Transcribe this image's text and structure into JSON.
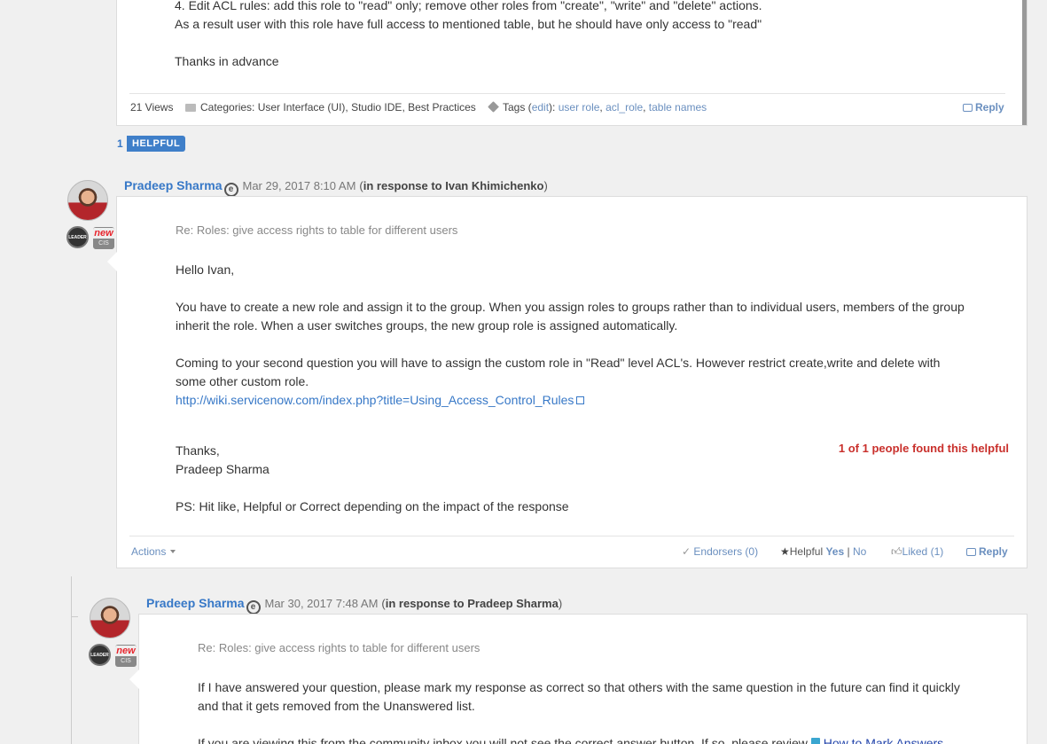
{
  "top_post": {
    "line1": "4. Edit ACL rules: add this role to \"read\" only; remove other roles from \"create\", \"write\" and \"delete\" actions.",
    "line2": "As a result user with this role have full access to mentioned table, but he should have only access to \"read\"",
    "thanks": "Thanks in advance",
    "views": "21 Views",
    "categories_label": "Categories:",
    "categories": "User Interface (UI), Studio IDE, Best Practices",
    "tags_label": "Tags (",
    "tags_edit": "edit",
    "tags_suffix": "):",
    "tags": [
      "user role",
      "acl_role",
      "table names"
    ],
    "reply_label": "Reply",
    "helpful_count": "1",
    "helpful_badge": "HELPFUL"
  },
  "reply1": {
    "author": "Pradeep Sharma",
    "date": "Mar 29, 2017 8:10 AM",
    "in_response_prefix": "(",
    "in_response": "in response to Ivan Khimichenko",
    "in_response_suffix": ")",
    "badge_leader": "LEADER",
    "badge_new": "new",
    "badge_cis": "CIS",
    "subject": "Re: Roles: give access rights to table for different users",
    "greeting": "Hello Ivan,",
    "para1": "You have to create a new role and assign it to the group. When you assign roles to groups rather than to individual users, members of the group inherit the role. When a user switches groups, the new group role is assigned automatically.",
    "para2": "Coming to your second question you will have to assign the custom role in \"Read\" level ACL's. However restrict create,write and delete with some other custom role.",
    "link": "http://wiki.servicenow.com/index.php?title=Using_Access_Control_Rules",
    "thanks": "Thanks,",
    "signature": "Pradeep Sharma",
    "ps": "PS: Hit like, Helpful or Correct depending on the impact of the response",
    "helpful_found": "1 of 1 people found this helpful",
    "actions": "Actions",
    "endorsers": "Endorsers (0)",
    "helpful_label": "Helpful",
    "helpful_yes": "Yes",
    "helpful_sep": "|",
    "helpful_no": "No",
    "liked": "Liked (1)",
    "reply_label": "Reply"
  },
  "reply2": {
    "author": "Pradeep Sharma",
    "date": "Mar 30, 2017 7:48 AM",
    "in_response_prefix": "(",
    "in_response": "in response to Pradeep Sharma",
    "in_response_suffix": ")",
    "badge_leader": "LEADER",
    "badge_new": "new",
    "badge_cis": "CIS",
    "subject": "Re: Roles: give access rights to table for different users",
    "para1": "If I have answered your question, please mark my response as correct so that others with the same question in the future can find it quickly and that it gets removed from the Unanswered list.",
    "para2_prefix": "If you are viewing this from the community inbox you will not see the correct answer button.  If so, please review",
    "para2_link": "How to Mark Answers"
  }
}
